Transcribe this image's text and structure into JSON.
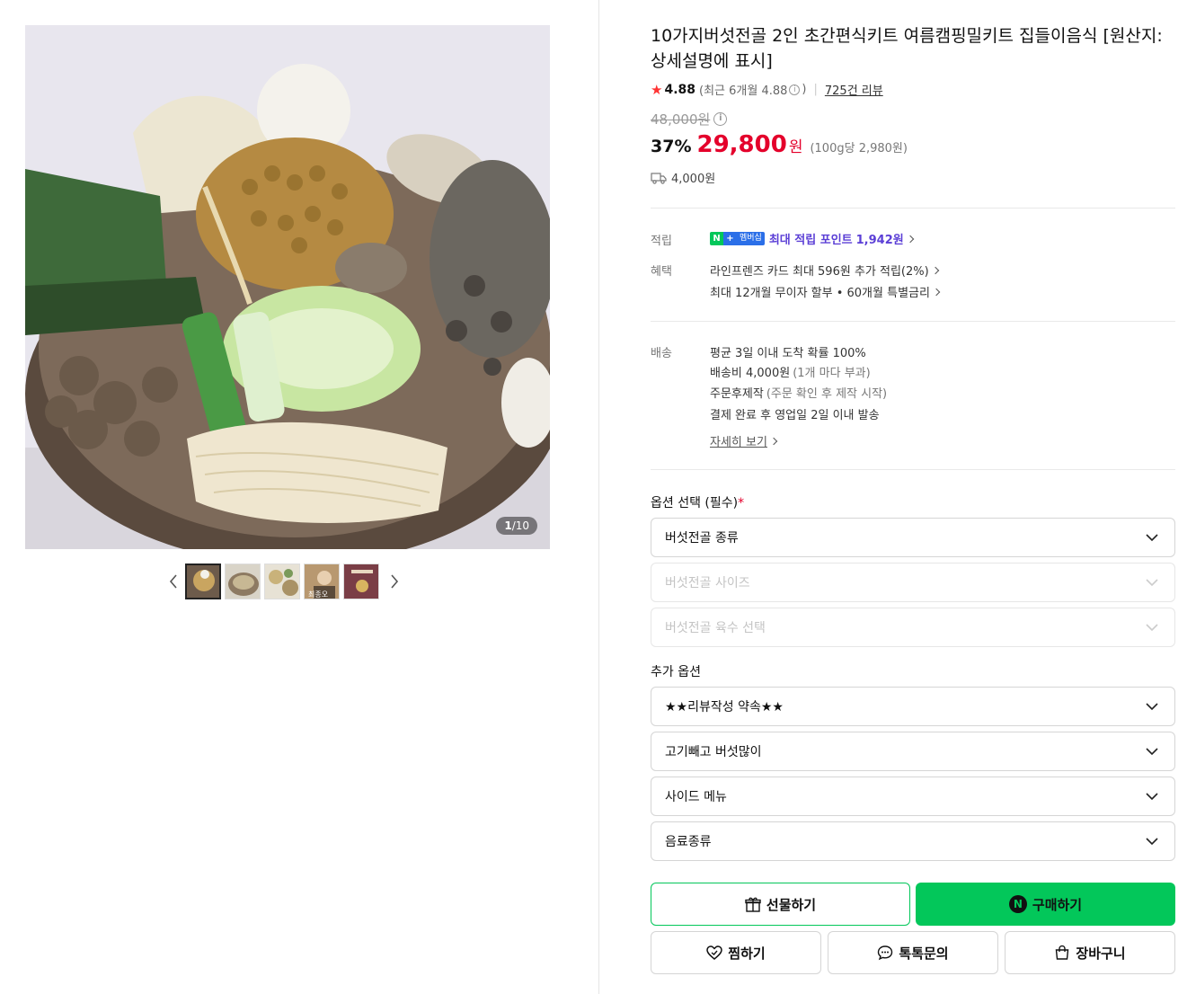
{
  "gallery": {
    "counter_current": "1",
    "counter_total": "/10",
    "thumbnail_text": "최종오"
  },
  "product": {
    "title": "10가지버섯전골 2인 초간편식키트 여름캠핑밀키트 집들이음식 [원산지:상세설명에 표시]",
    "rating": "4.88",
    "recent_rating": "(최근 6개월 4.88",
    "recent_rating_close": ")",
    "review_count": "725건 리뷰",
    "original_price": "48,000원",
    "discount": "37%",
    "price": "29,800",
    "won": "원",
    "unit_price": "(100g당 2,980원)",
    "shipping_fee": "4,000원"
  },
  "benefits": {
    "points_label": "적립",
    "badge_n": "N",
    "badge_plus": "+",
    "badge_member": "멤버십",
    "points_text": "최대 적립 포인트",
    "points_value": "1,942원",
    "perks_label": "혜택",
    "card_benefit": "라인프렌즈 카드 최대 596원 추가 적립(2%)",
    "installment": "최대 12개월 무이자 할부 • 60개월 특별금리"
  },
  "delivery": {
    "label": "배송",
    "arrival": "평균 3일 이내 도착 확률 100%",
    "fee": "배송비 4,000원",
    "fee_note": "(1개 마다 부과)",
    "made_to_order": "주문후제작",
    "made_to_order_note": "(주문 확인 후 제작 시작)",
    "dispatch": "결제 완료 후 영업일 2일 이내 발송",
    "detail_link": "자세히 보기"
  },
  "options": {
    "title": "옵션 선택 (필수)",
    "required_mark": "*",
    "required": [
      "버섯전골 종류",
      "버섯전골 사이즈",
      "버섯전골 육수 선택"
    ],
    "extra_title": "추가 옵션",
    "extra": [
      "★★리뷰작성 약속★★",
      "고기빼고 버섯많이",
      "사이드 메뉴",
      "음료종류"
    ]
  },
  "actions": {
    "gift": "선물하기",
    "buy": "구매하기",
    "buy_icon": "N",
    "wishlist": "찜하기",
    "talk": "톡톡문의",
    "cart": "장바구니"
  },
  "colors": {
    "brand_green": "#03c75a",
    "price_red": "#e4002b",
    "points_purple": "#5b3fd6"
  },
  "icons": [
    "chevron-left-icon",
    "chevron-right-icon",
    "star-icon",
    "info-icon",
    "truck-icon",
    "chevron-down-icon",
    "gift-icon",
    "heart-icon",
    "chat-icon",
    "bag-icon"
  ]
}
